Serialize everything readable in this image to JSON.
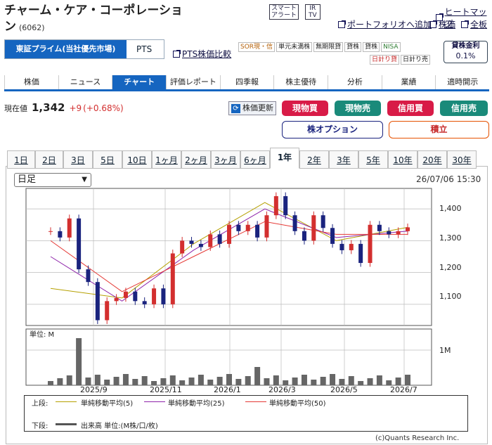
{
  "header": {
    "company_line1": "チャーム・ケア・コーポレーショ",
    "company_line2": "ン",
    "code": "(6062)",
    "smart_alert_1": "スマート",
    "smart_alert_2": "アラート",
    "ir_1": "IR",
    "ir_2": "TV",
    "heatmap": "ヒートマップ",
    "portfolio_add": "ポートフォリオへ追加",
    "stock": "株価",
    "board": "全板"
  },
  "market": {
    "primary": "東証プライム(当社優先市場)",
    "pts": "PTS",
    "pts_compare": "PTS株価比較",
    "tags": [
      "SOR現・信",
      "単元未満株",
      "無期限貸",
      "貸株",
      "貸株",
      "NISA"
    ],
    "tags2": [
      "日計り貸",
      "日計り売"
    ],
    "lending_label": "貸株金利",
    "lending_rate": "0.1%"
  },
  "tabs": [
    {
      "label": "株価"
    },
    {
      "label": "ニュース"
    },
    {
      "label": "チャート"
    },
    {
      "label": "評価レポート"
    },
    {
      "label": "四季報"
    },
    {
      "label": "株主優待"
    },
    {
      "label": "分析"
    },
    {
      "label": "業績"
    },
    {
      "label": "適時開示"
    }
  ],
  "quote": {
    "label": "現在値",
    "price": "1,342",
    "change": "+9",
    "pct": "(+0.68%)",
    "refresh": "株価更新"
  },
  "actions": {
    "cash_buy": "現物買",
    "cash_sell": "現物売",
    "margin_buy": "信用買",
    "margin_sell": "信用売",
    "option": "株オプション",
    "accumulate": "積立"
  },
  "colors": {
    "accent": "#1565c0",
    "buy": "#d81b47",
    "sell": "#1a8a7a",
    "up": "#d32f2f",
    "down": "#1a237e"
  },
  "ranges": [
    {
      "label": "1日"
    },
    {
      "label": "2日"
    },
    {
      "label": "3日"
    },
    {
      "label": "5日"
    },
    {
      "label": "10日"
    },
    {
      "label": "1ヶ月"
    },
    {
      "label": "2ヶ月"
    },
    {
      "label": "3ヶ月"
    },
    {
      "label": "6ヶ月"
    },
    {
      "label": "1年"
    },
    {
      "label": "2年"
    },
    {
      "label": "3年"
    },
    {
      "label": "5年"
    },
    {
      "label": "10年"
    },
    {
      "label": "20年"
    },
    {
      "label": "30年"
    }
  ],
  "chart": {
    "period_select": "日足",
    "timestamp": "26/07/06 15:30",
    "y_ticks": [
      "1,400",
      "1,300",
      "1,200",
      "1,100"
    ],
    "x_ticks": [
      "2025/9",
      "2025/11",
      "2026/1",
      "2026/3",
      "2026/5",
      "2026/7"
    ],
    "volume_unit": "単位: M",
    "volume_tick": "1M",
    "legend": {
      "upper": "上段:",
      "ma5": "単純移動平均(5)",
      "ma25": "単純移動平均(25)",
      "ma50": "単純移動平均(50)",
      "lower": "下段:",
      "volume": "出来高 単位:(M株/口/枚)"
    },
    "credit": "(c)Quants Research Inc."
  },
  "chart_data": {
    "type": "line",
    "title": "",
    "ylim": [
      1040,
      1460
    ],
    "x": [
      "2025/9",
      "2025/11",
      "2026/1",
      "2026/3",
      "2026/5",
      "2026/7"
    ],
    "series": [
      {
        "name": "単純移動平均(5)",
        "values": [
          1150,
          1120,
          1290,
          1420,
          1300,
          1342
        ]
      },
      {
        "name": "単純移動平均(25)",
        "values": [
          1250,
          1110,
          1270,
          1400,
          1310,
          1330
        ]
      },
      {
        "name": "単純移動平均(50)",
        "values": [
          1300,
          1140,
          1250,
          1360,
          1320,
          1320
        ]
      }
    ],
    "close": [
      1330,
      1310,
      1370,
      1210,
      1170,
      1050,
      1110,
      1120,
      1140,
      1110,
      1100,
      1150,
      1100,
      1260,
      1300,
      1290,
      1280,
      1320,
      1290,
      1350,
      1330,
      1350,
      1310,
      1380,
      1440,
      1380,
      1330,
      1300,
      1380,
      1340,
      1290,
      1270,
      1290,
      1230,
      1350,
      1330,
      1320,
      1330,
      1342
    ]
  }
}
